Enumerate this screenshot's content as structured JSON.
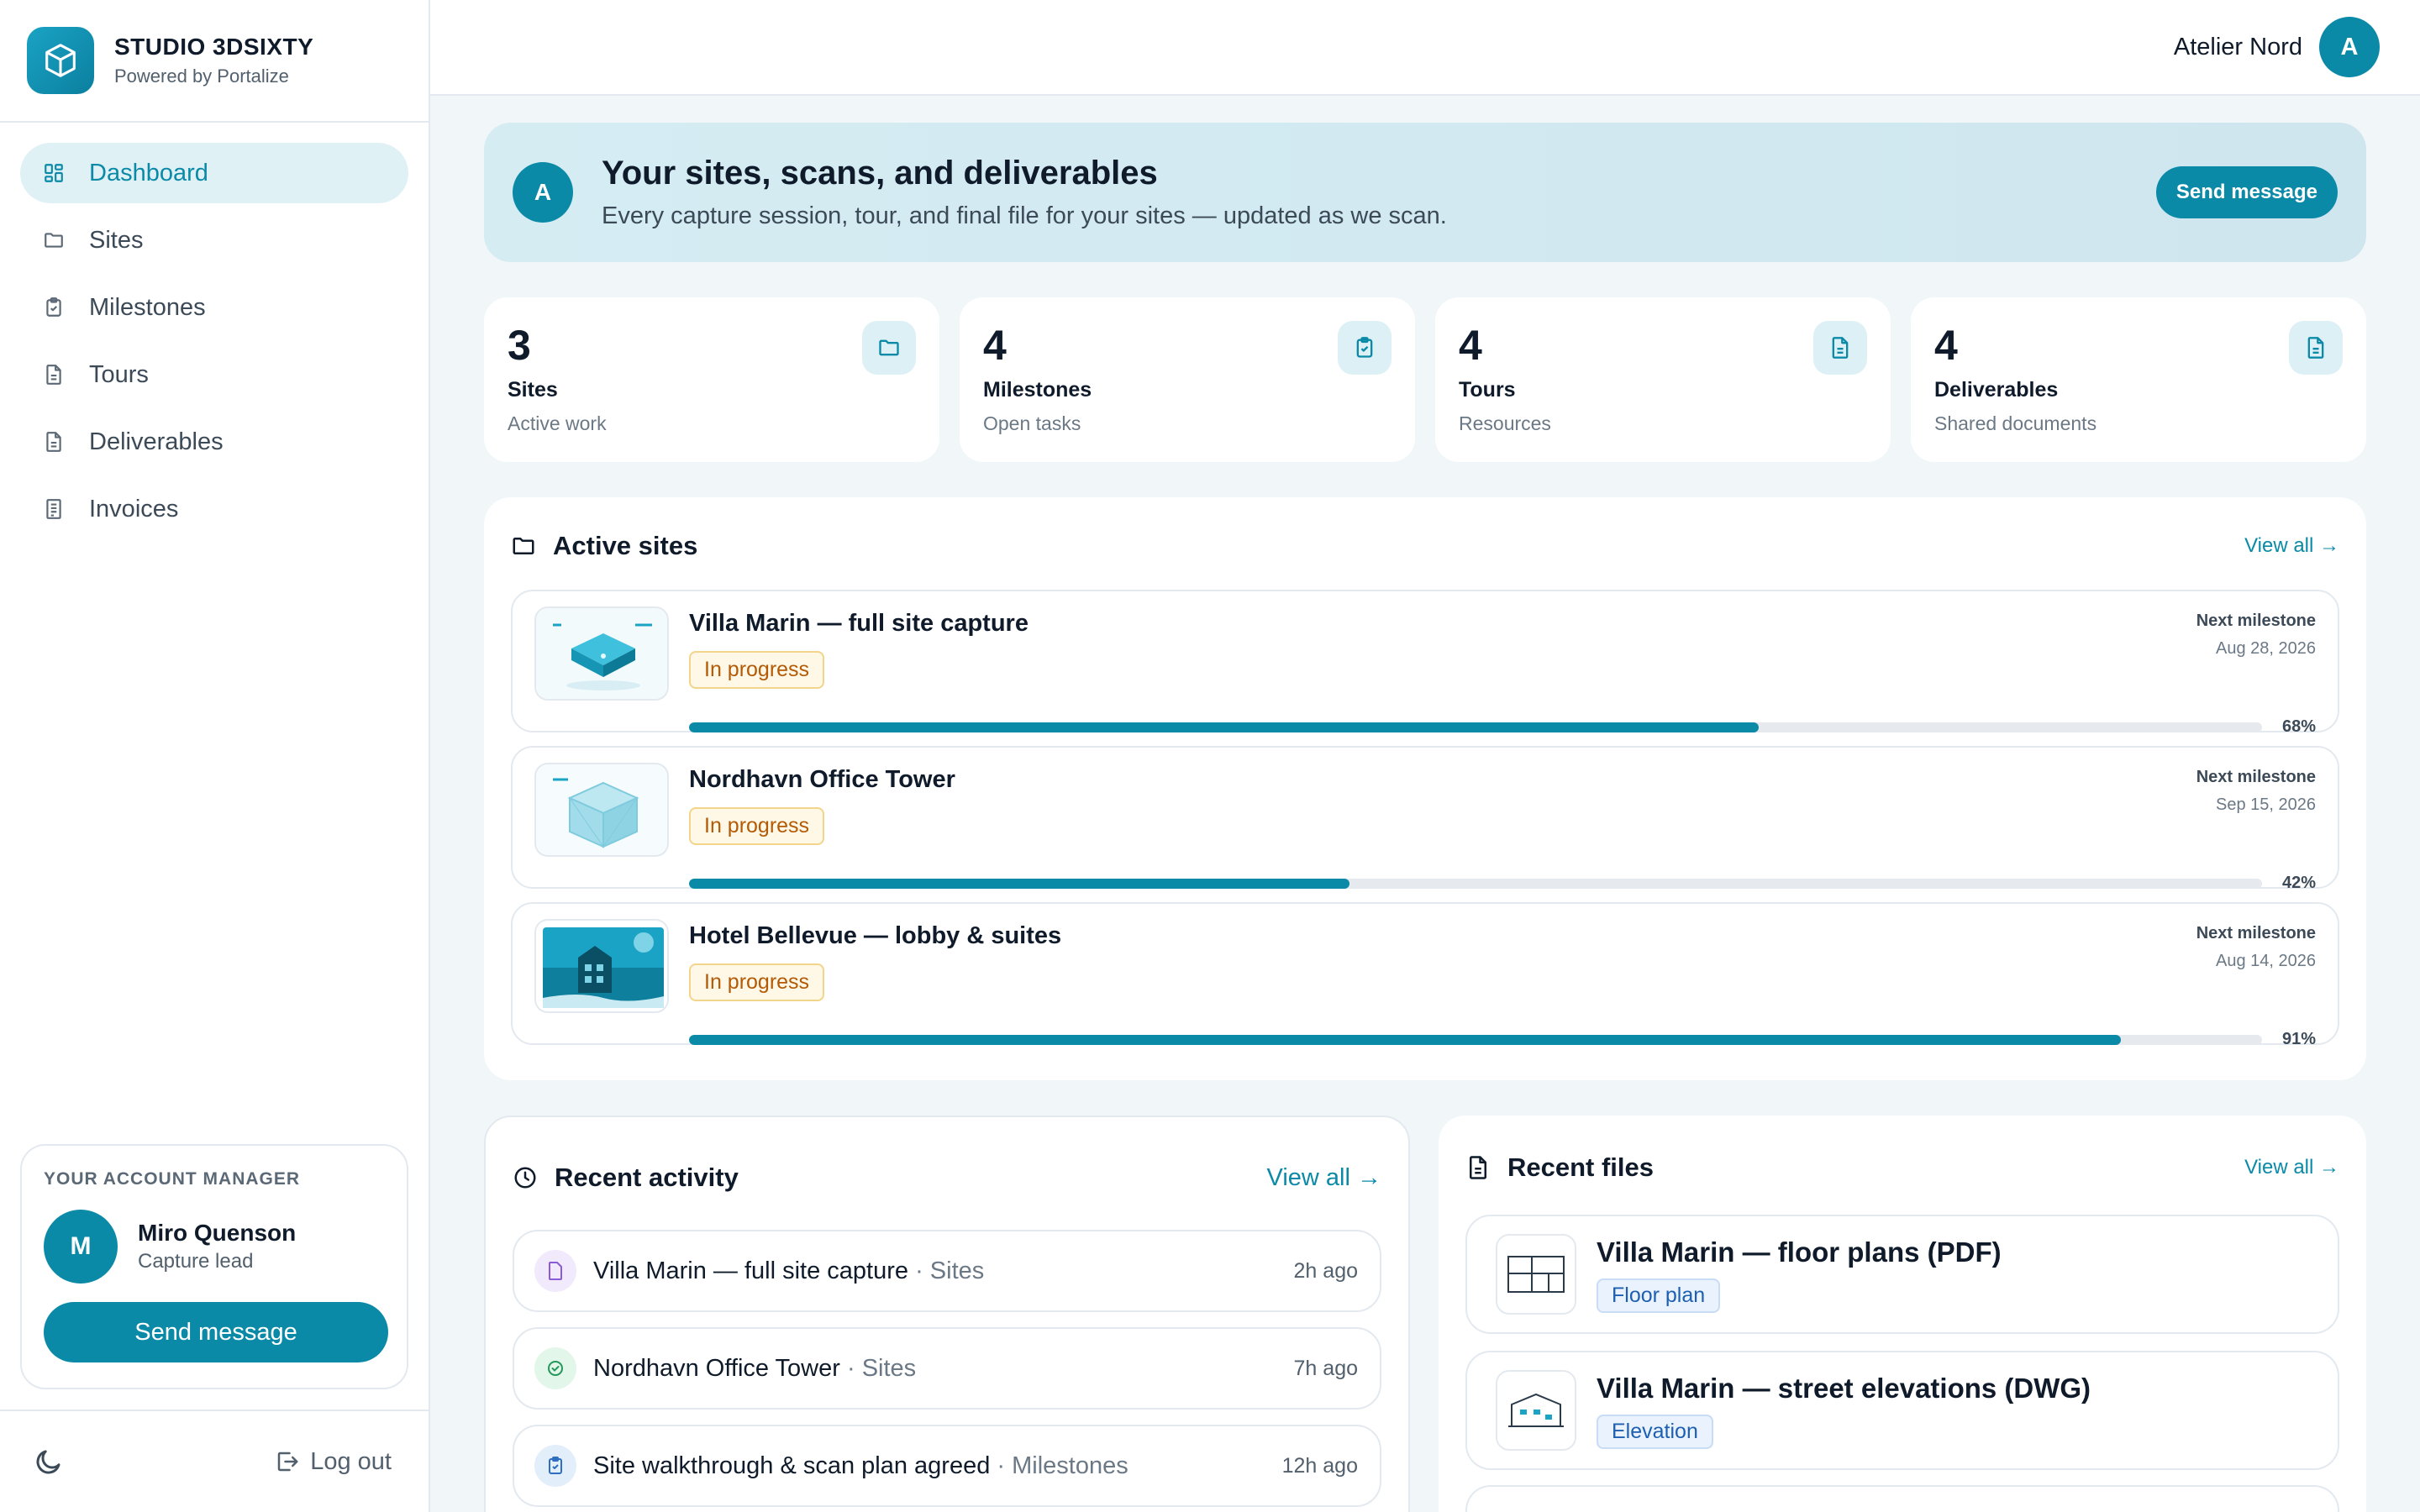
{
  "brand": {
    "name": "STUDIO 3DSIXTY",
    "subtitle": "Powered by Portalize"
  },
  "nav": [
    {
      "label": "Dashboard",
      "icon": "grid-icon",
      "active": true
    },
    {
      "label": "Sites",
      "icon": "folder-icon"
    },
    {
      "label": "Milestones",
      "icon": "clipboard-check-icon"
    },
    {
      "label": "Tours",
      "icon": "document-icon"
    },
    {
      "label": "Deliverables",
      "icon": "document-icon"
    },
    {
      "label": "Invoices",
      "icon": "receipt-icon"
    }
  ],
  "account_manager": {
    "label": "YOUR ACCOUNT MANAGER",
    "initial": "M",
    "name": "Miro Quenson",
    "role": "Capture lead",
    "button": "Send message"
  },
  "footer": {
    "logout": "Log out",
    "theme_icon": "moon-icon"
  },
  "header": {
    "org_name": "Atelier Nord",
    "org_initial": "A"
  },
  "hero": {
    "initial": "A",
    "title": "Your sites, scans, and deliverables",
    "subtitle": "Every capture session, tour, and final file for your sites — updated as we scan.",
    "button": "Send message"
  },
  "stats": [
    {
      "value": "3",
      "title": "Sites",
      "subtitle": "Active work",
      "icon": "folder-icon"
    },
    {
      "value": "4",
      "title": "Milestones",
      "subtitle": "Open tasks",
      "icon": "clipboard-check-icon"
    },
    {
      "value": "4",
      "title": "Tours",
      "subtitle": "Resources",
      "icon": "document-icon"
    },
    {
      "value": "4",
      "title": "Deliverables",
      "subtitle": "Shared documents",
      "icon": "document-icon"
    }
  ],
  "active_sites": {
    "title": "Active sites",
    "view_all": "View all →",
    "milestone_label": "Next milestone",
    "items": [
      {
        "name": "Villa Marin — full site capture",
        "status": "In progress",
        "date": "Aug 28, 2026",
        "progress": 68,
        "progress_label": "68%"
      },
      {
        "name": "Nordhavn Office Tower",
        "status": "In progress",
        "date": "Sep 15, 2026",
        "progress": 42,
        "progress_label": "42%"
      },
      {
        "name": "Hotel Bellevue — lobby & suites",
        "status": "In progress",
        "date": "Aug 14, 2026",
        "progress": 91,
        "progress_label": "91%"
      }
    ]
  },
  "recent_activity": {
    "title": "Recent activity",
    "view_all": "View all →",
    "items": [
      {
        "title": "Villa Marin — full site capture",
        "category": " · Sites",
        "time": "2h ago",
        "icon": "document-icon",
        "color": "#f0eafc"
      },
      {
        "title": "Nordhavn Office Tower",
        "category": " · Sites",
        "time": "7h ago",
        "icon": "check-circle-icon",
        "color": "#e3f6ea"
      },
      {
        "title": "Site walkthrough & scan plan agreed",
        "category": " · Milestones",
        "time": "12h ago",
        "icon": "clipboard-check-icon",
        "color": "#e3eefb"
      }
    ]
  },
  "recent_files": {
    "title": "Recent files",
    "view_all": "View all →",
    "items": [
      {
        "name": "Villa Marin — floor plans (PDF)",
        "tag": "Floor plan",
        "icon": "floor-plan-icon"
      },
      {
        "name": "Villa Marin — street elevations (DWG)",
        "tag": "Elevation",
        "icon": "elevation-icon"
      }
    ]
  },
  "colors": {
    "accent": "#0b8aa8",
    "badge_warning": "#b25a06",
    "tag_blue": "#1d5fb0"
  }
}
